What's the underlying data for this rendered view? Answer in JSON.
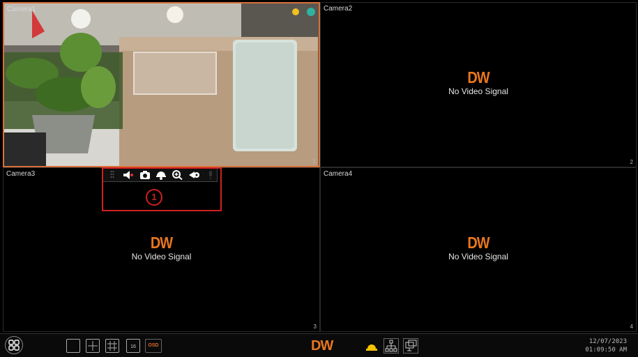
{
  "tiles": [
    {
      "label": "Camera1",
      "number": "1"
    },
    {
      "label": "Camera2",
      "number": "2",
      "logo": "DW",
      "status": "No Video Signal"
    },
    {
      "label": "Camera3",
      "number": "3",
      "logo": "DW",
      "status": "No Video Signal"
    },
    {
      "label": "Camera4",
      "number": "4",
      "logo": "DW",
      "status": "No Video Signal"
    }
  ],
  "callout": "1",
  "toolbar": {
    "icons": [
      "drag-handle-icon",
      "mute-icon",
      "snapshot-icon",
      "ptz-icon",
      "zoom-in-icon",
      "record-icon",
      "mic-icon"
    ]
  },
  "bottom_bar": {
    "osd_label": "OSD",
    "logo": "DW",
    "date": "12/07/2023",
    "time": "01:09:50 AM"
  },
  "colors": {
    "accent": "#e8761e",
    "highlight": "#d02020",
    "selected_border": "#d9703a"
  }
}
